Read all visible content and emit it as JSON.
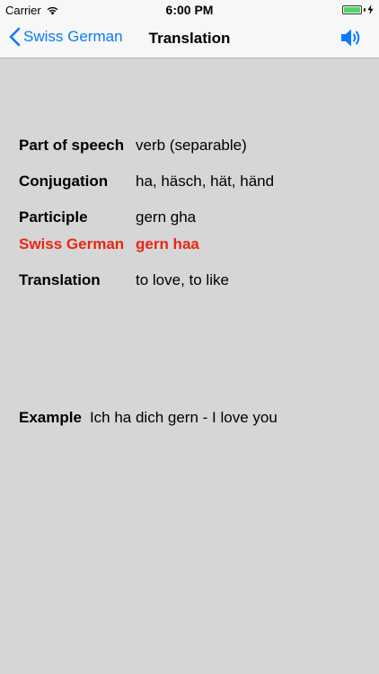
{
  "status_bar": {
    "carrier": "Carrier",
    "time": "6:00 PM",
    "icons": [
      "wifi-icon",
      "battery-icon",
      "charging-icon"
    ],
    "battery_level": 1.0
  },
  "nav": {
    "back_label": "Swiss German",
    "title": "Translation",
    "icons": [
      "chevron-left-icon",
      "speaker-icon"
    ],
    "accent_color": "#0a7aff"
  },
  "entry": {
    "part_of_speech_label": "Part of speech",
    "part_of_speech": "verb (separable)",
    "conjugation_label": "Conjugation",
    "conjugation": "ha, häsch, hät, händ",
    "participle_label": "Participle",
    "participle": "gern gha",
    "swiss_german_label": "Swiss German",
    "swiss_german": "gern haa",
    "translation_label": "Translation",
    "translation": "to love, to like",
    "highlight_color": "#ea2516"
  },
  "example": {
    "label": "Example",
    "text": "Ich ha dich gern - I love you"
  }
}
